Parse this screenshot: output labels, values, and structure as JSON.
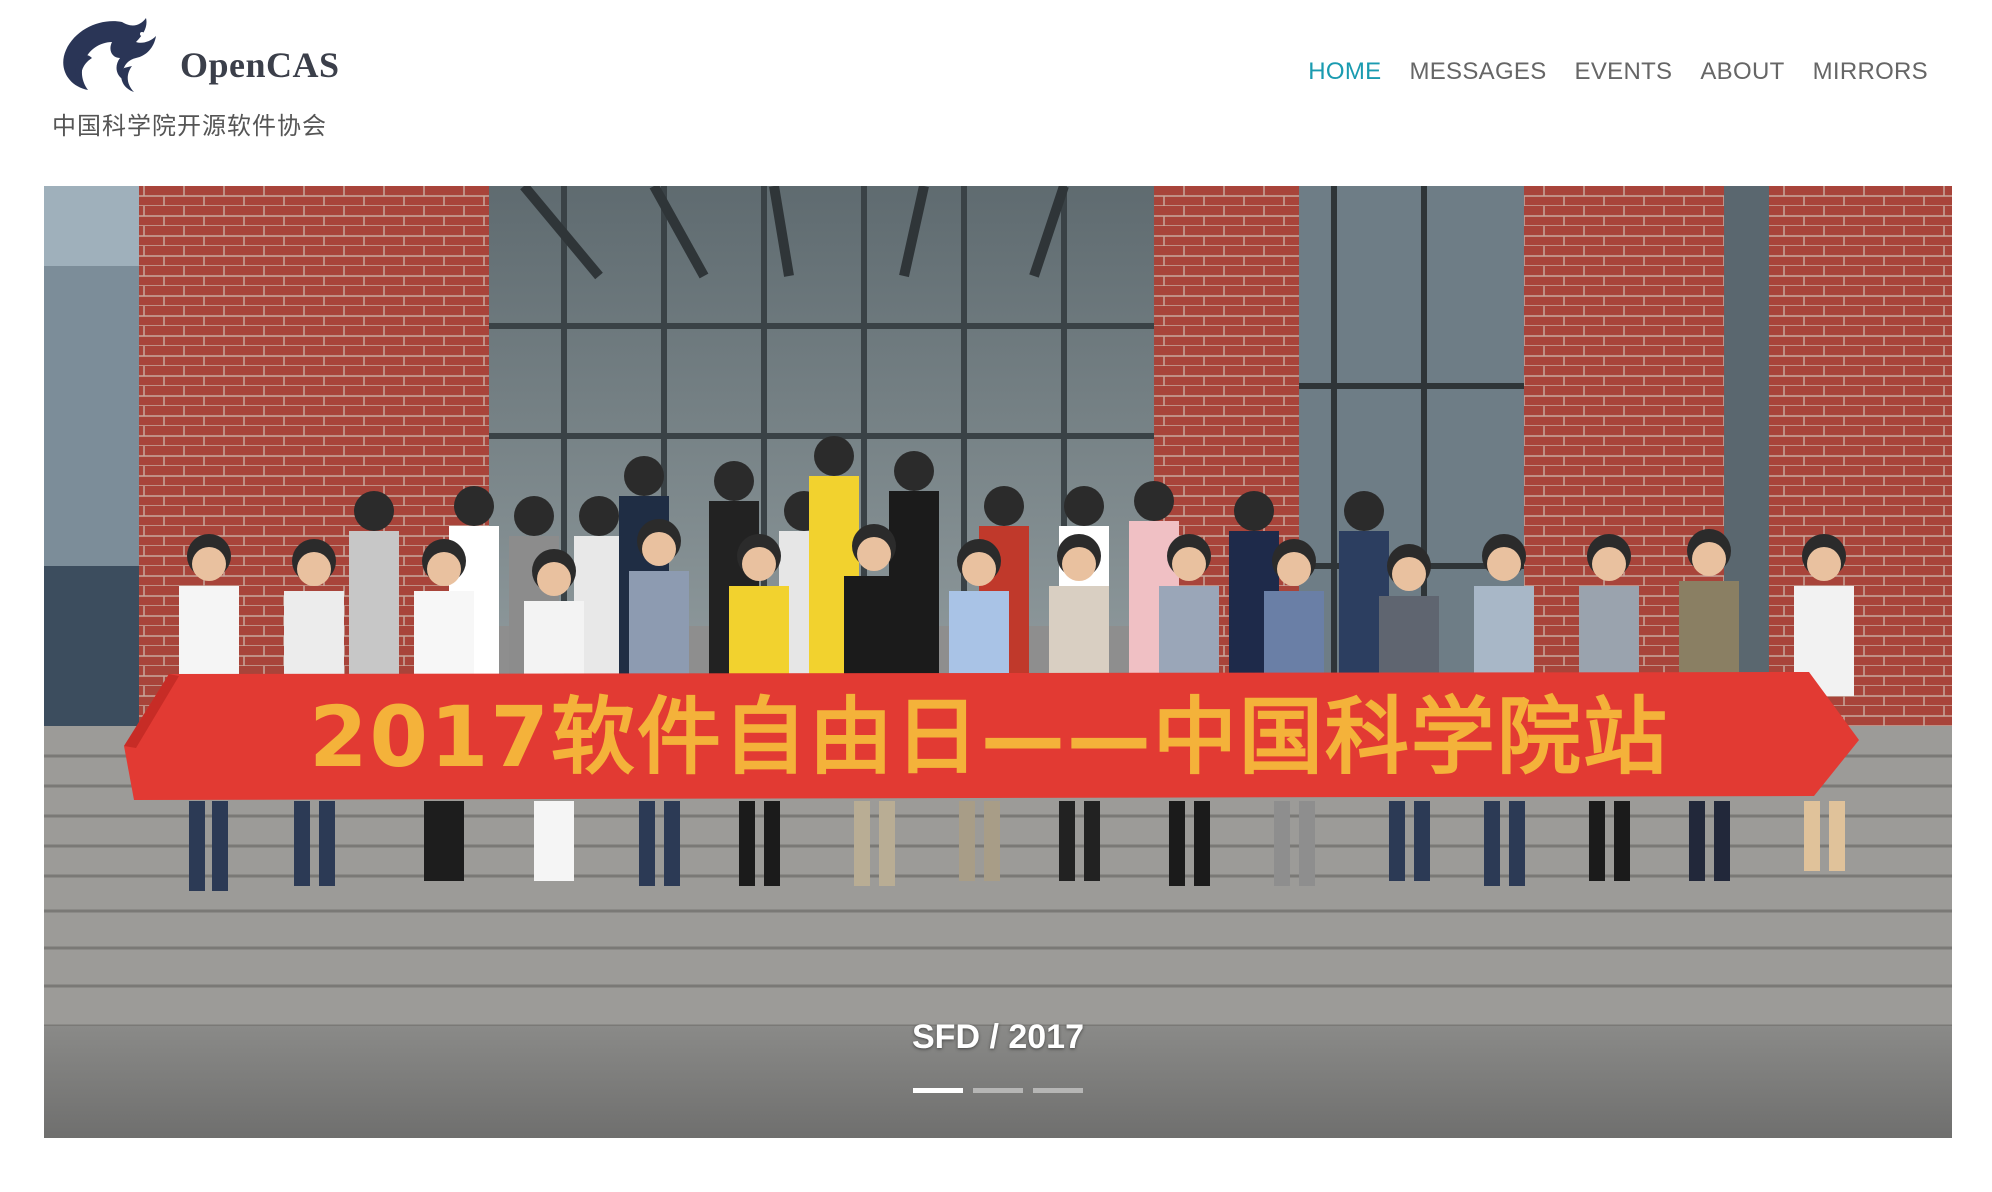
{
  "brand": {
    "name": "OpenCAS",
    "subtitle": "中国科学院开源软件协会"
  },
  "nav": {
    "items": [
      {
        "label": "HOME",
        "active": true
      },
      {
        "label": "MESSAGES",
        "active": false
      },
      {
        "label": "EVENTS",
        "active": false
      },
      {
        "label": "ABOUT",
        "active": false
      },
      {
        "label": "MIRRORS",
        "active": false
      }
    ]
  },
  "carousel": {
    "caption": "SFD / 2017",
    "banner_text": "2017软件自由日——中国科学院站",
    "slide_count": 3,
    "active_slide": 1
  },
  "colors": {
    "accent": "#1a9bb0",
    "nav_text": "#666666",
    "brand_text": "#3b3f4a",
    "banner_red": "#e23a33",
    "banner_text": "#f4b23a",
    "brick": "#a8443a"
  }
}
